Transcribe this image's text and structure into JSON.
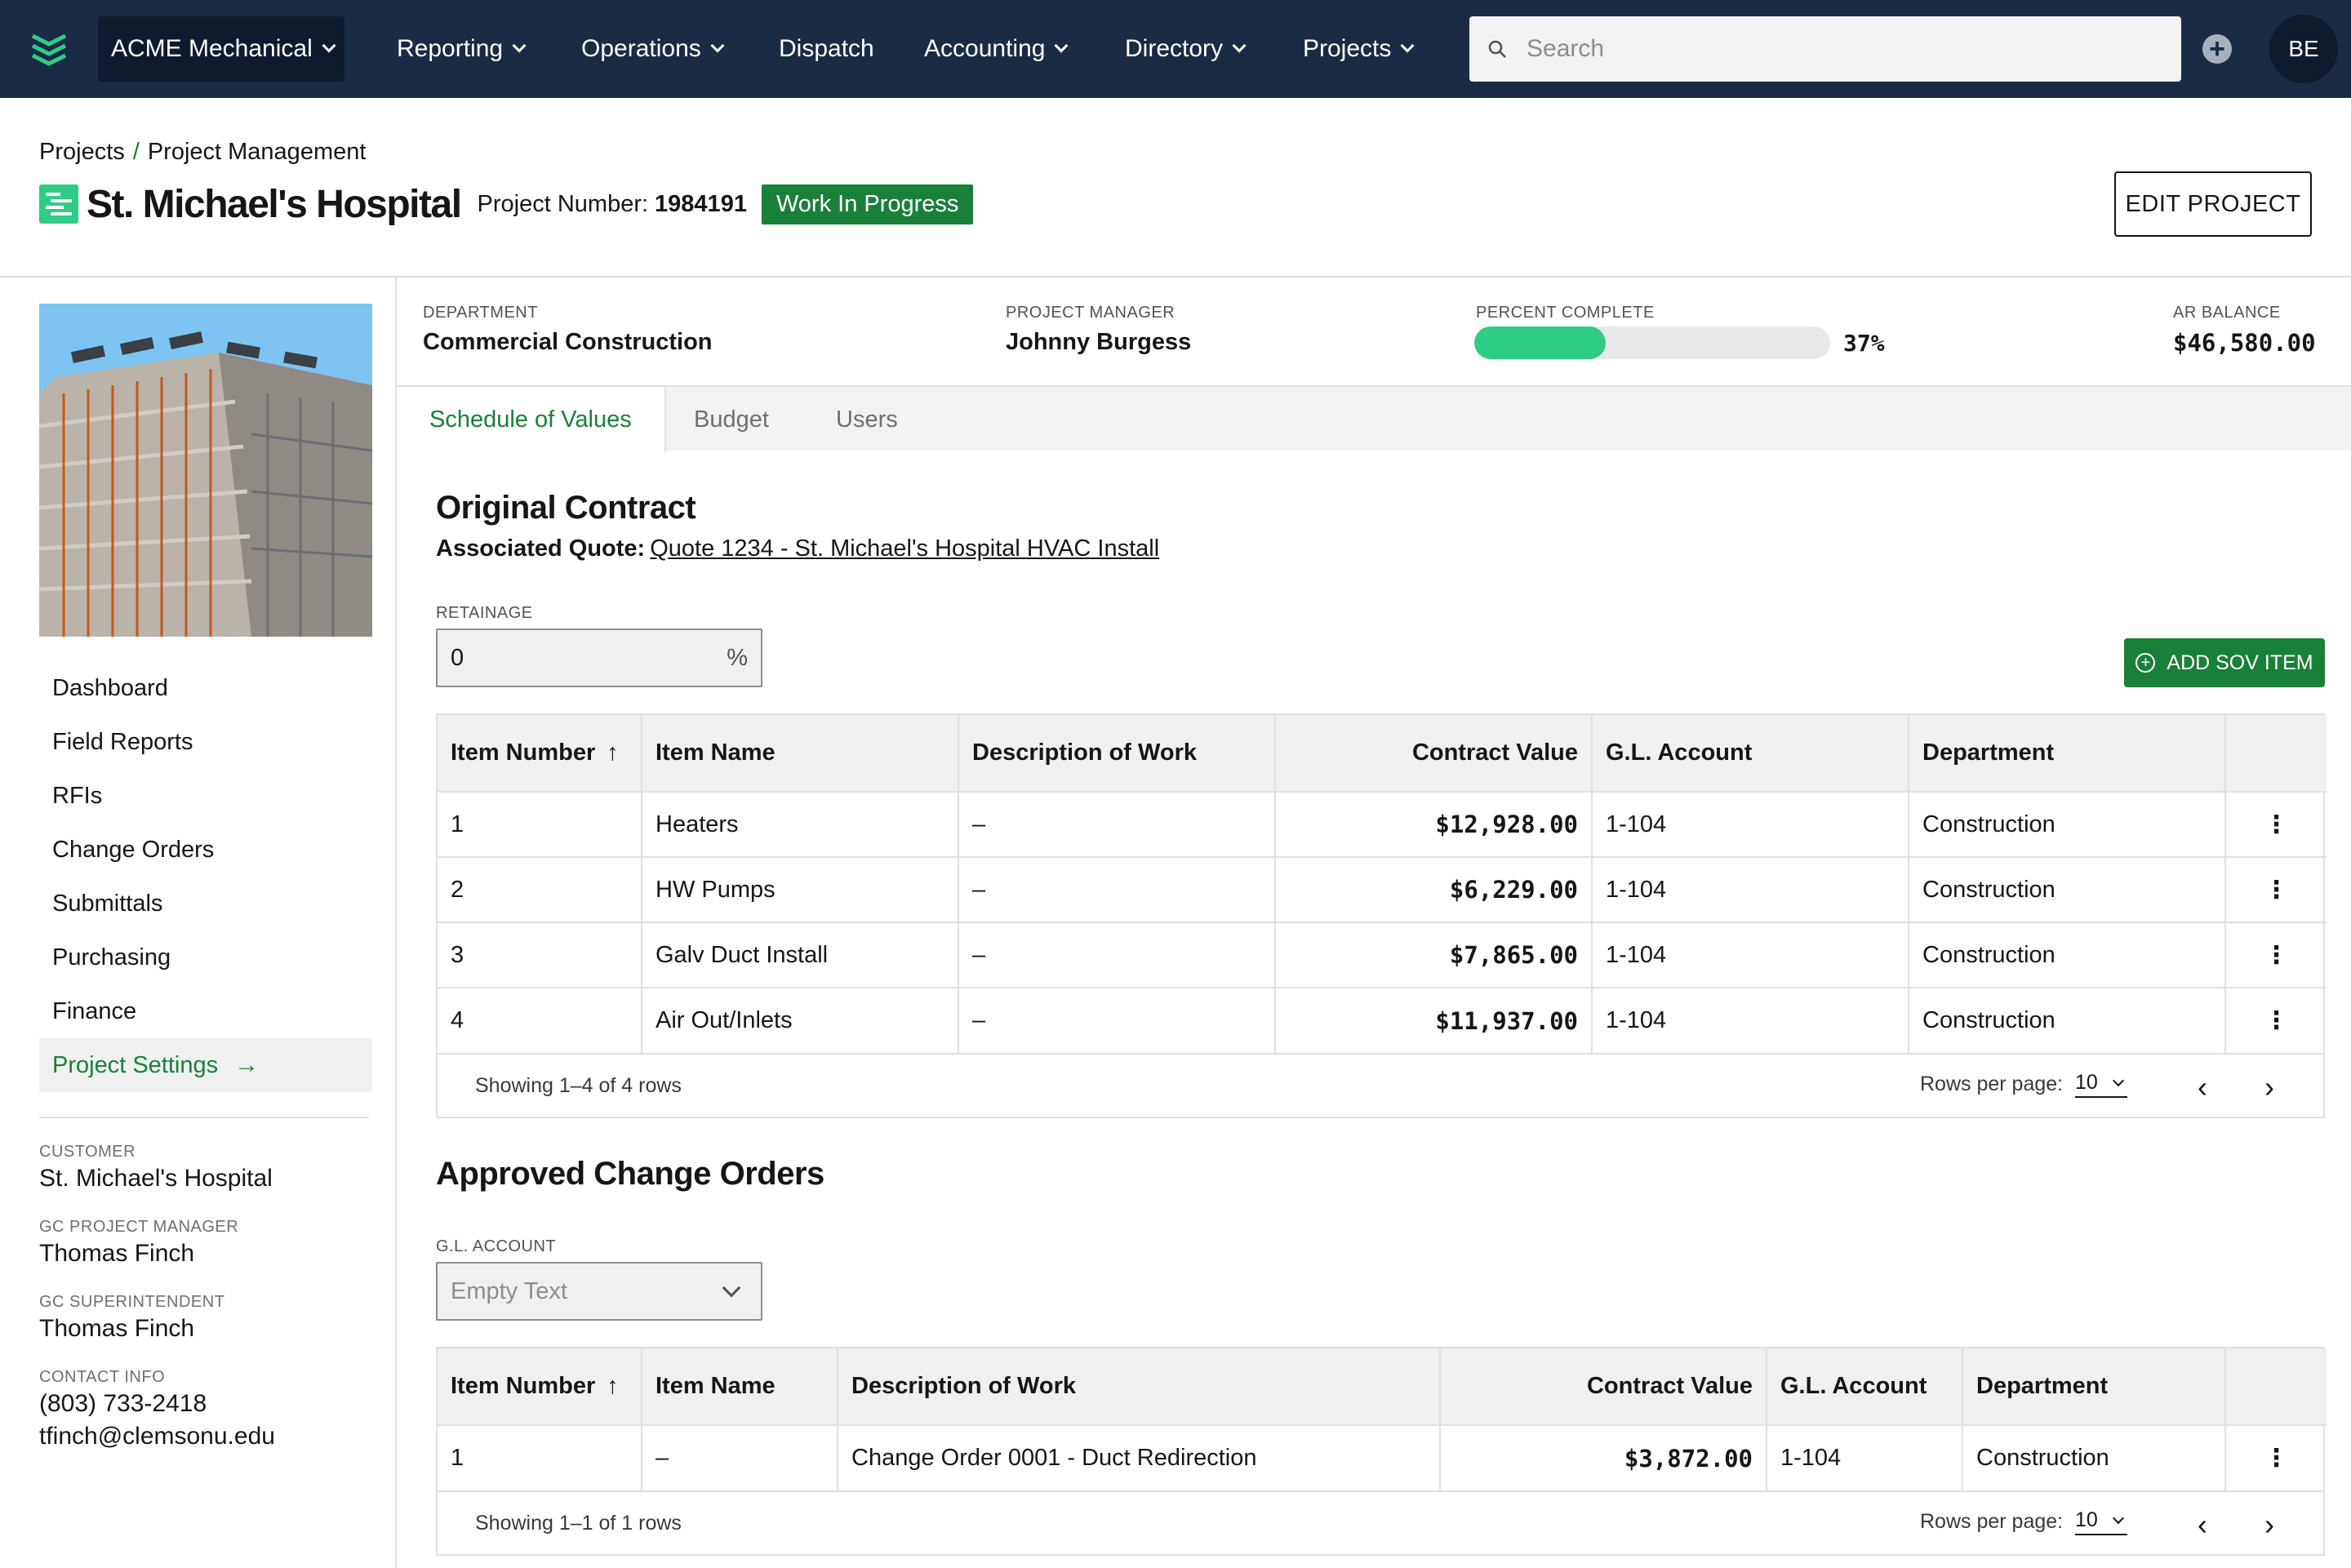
{
  "topnav": {
    "company": "ACME Mechanical",
    "items": [
      {
        "label": "Reporting",
        "dropdown": true
      },
      {
        "label": "Operations",
        "dropdown": true
      },
      {
        "label": "Dispatch",
        "dropdown": false
      },
      {
        "label": "Accounting",
        "dropdown": true
      },
      {
        "label": "Directory",
        "dropdown": true
      },
      {
        "label": "Projects",
        "dropdown": true
      }
    ],
    "search_placeholder": "Search",
    "avatar_initials": "BE"
  },
  "breadcrumb": {
    "root": "Projects",
    "separator": "/",
    "current": "Project Management"
  },
  "header": {
    "title": "St. Michael's Hospital",
    "project_number_label": "Project Number:",
    "project_number": "1984191",
    "status": "Work In Progress",
    "edit_label": "EDIT PROJECT"
  },
  "metrics": {
    "department": {
      "label": "DEPARTMENT",
      "value": "Commercial Construction"
    },
    "project_manager": {
      "label": "PROJECT MANAGER",
      "value": "Johnny Burgess"
    },
    "percent_complete": {
      "label": "PERCENT COMPLETE",
      "value": 37,
      "display": "37%"
    },
    "ar_balance": {
      "label": "AR BALANCE",
      "value": "$46,580.00"
    }
  },
  "sidebar": {
    "nav": [
      {
        "label": "Dashboard"
      },
      {
        "label": "Field Reports"
      },
      {
        "label": "RFIs"
      },
      {
        "label": "Change Orders"
      },
      {
        "label": "Submittals"
      },
      {
        "label": "Purchasing"
      },
      {
        "label": "Finance"
      },
      {
        "label": "Project Settings",
        "active": true
      }
    ],
    "info": {
      "customer_label": "CUSTOMER",
      "customer": "St. Michael's Hospital",
      "gc_pm_label": "GC PROJECT MANAGER",
      "gc_pm": "Thomas Finch",
      "gc_super_label": "GC SUPERINTENDENT",
      "gc_super": "Thomas Finch",
      "contact_label": "CONTACT INFO",
      "phone": "(803) 733-2418",
      "email": "tfinch@clemsonu.edu"
    }
  },
  "tabs": [
    {
      "label": "Schedule of Values",
      "active": true
    },
    {
      "label": "Budget"
    },
    {
      "label": "Users"
    }
  ],
  "original_contract": {
    "title": "Original Contract",
    "assoc_label": "Associated Quote:",
    "assoc_link": "Quote 1234 - St. Michael's Hospital HVAC Install",
    "retainage_label": "RETAINAGE",
    "retainage_value": "0",
    "retainage_unit": "%",
    "add_label": "ADD SOV ITEM",
    "columns": [
      "Item Number",
      "Item Name",
      "Description of Work",
      "Contract Value",
      "G.L. Account",
      "Department"
    ],
    "rows": [
      {
        "num": "1",
        "name": "Heaters",
        "desc": "–",
        "value": "$12,928.00",
        "gl": "1-104",
        "dept": "Construction"
      },
      {
        "num": "2",
        "name": "HW Pumps",
        "desc": "–",
        "value": "$6,229.00",
        "gl": "1-104",
        "dept": "Construction"
      },
      {
        "num": "3",
        "name": "Galv Duct Install",
        "desc": "–",
        "value": "$7,865.00",
        "gl": "1-104",
        "dept": "Construction"
      },
      {
        "num": "4",
        "name": "Air Out/Inlets",
        "desc": "–",
        "value": "$11,937.00",
        "gl": "1-104",
        "dept": "Construction"
      }
    ],
    "footer_text": "Showing 1–4 of 4 rows",
    "rows_per_page_label": "Rows per page:",
    "rows_per_page": "10"
  },
  "approved_change_orders": {
    "title": "Approved Change Orders",
    "gl_label": "G.L. ACCOUNT",
    "gl_placeholder": "Empty Text",
    "columns": [
      "Item Number",
      "Item Name",
      "Description of Work",
      "Contract Value",
      "G.L. Account",
      "Department"
    ],
    "rows": [
      {
        "num": "1",
        "name": "–",
        "desc": "Change Order 0001 - Duct Redirection",
        "value": "$3,872.00",
        "gl": "1-104",
        "dept": "Construction"
      }
    ],
    "footer_text": "Showing 1–1 of 1 rows",
    "rows_per_page_label": "Rows per page:",
    "rows_per_page": "10"
  },
  "colors": {
    "navbar": "#1b2a45",
    "brand_green": "#198038",
    "progress_green": "#2ecc85"
  }
}
